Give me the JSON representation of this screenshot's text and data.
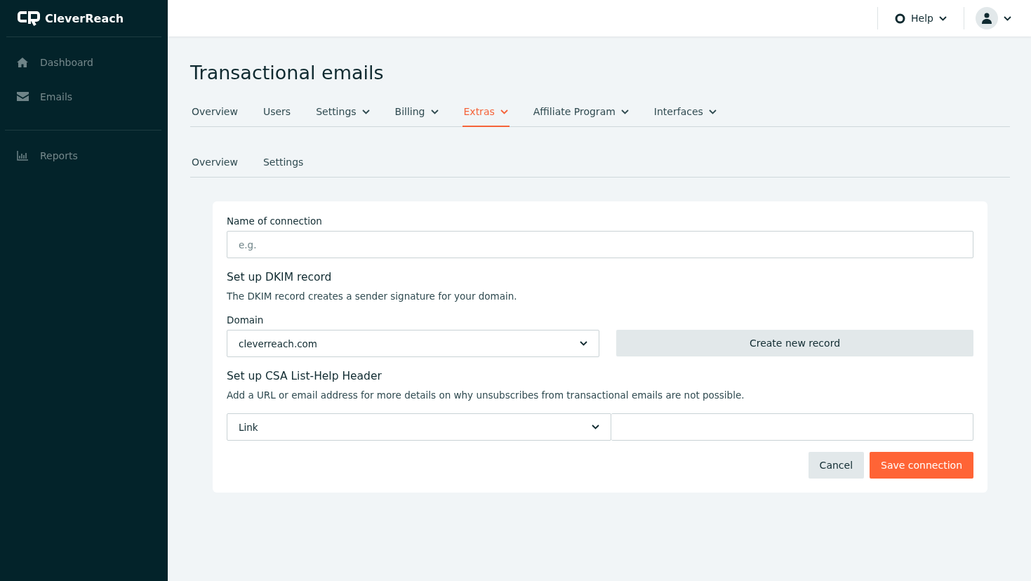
{
  "logo": {
    "text": "CleverReach"
  },
  "sidebar": {
    "sections": [
      {
        "items": [
          {
            "label": "Dashboard",
            "kind": "home",
            "selected": false
          },
          {
            "label": "Emails",
            "kind": "mail",
            "selected": false
          }
        ]
      },
      {
        "items": [
          {
            "label": "Reports",
            "kind": "chart",
            "selected": false
          }
        ]
      }
    ]
  },
  "header": {
    "help": {
      "label": "Help"
    }
  },
  "page": {
    "title": "Transactional emails"
  },
  "tabs": [
    {
      "label": "Overview",
      "dropdown": false,
      "selected": false
    },
    {
      "label": "Users",
      "dropdown": false,
      "selected": false
    },
    {
      "label": "Settings",
      "dropdown": true,
      "selected": false
    },
    {
      "label": "Billing",
      "dropdown": true,
      "selected": false
    },
    {
      "label": "Extras",
      "dropdown": true,
      "selected": true
    },
    {
      "label": "Affiliate Program",
      "dropdown": true,
      "selected": false
    },
    {
      "label": "Interfaces",
      "dropdown": true,
      "selected": false
    }
  ],
  "subtabs": [
    {
      "label": "Overview",
      "dropdown": false,
      "selected": false
    },
    {
      "label": "Settings",
      "dropdown": false,
      "selected": false
    }
  ],
  "form": {
    "name_field": {
      "label": "Name of connection",
      "placeholder": "e.g."
    },
    "dkim": {
      "title": "Set up DKIM record",
      "description": "The DKIM record creates a sender signature for your domain."
    },
    "domain": {
      "label": "Domain",
      "value": "cleverreach.com"
    },
    "create_button": "Create new record",
    "csa": {
      "title": "Set up CSA List-Help Header",
      "description": "Add a URL or email address for more details on why unsubscribes from transactional emails are not possible."
    },
    "link_type": {
      "value": "Link"
    },
    "buttons": {
      "cancel": "Cancel",
      "save": "Save connection"
    }
  }
}
